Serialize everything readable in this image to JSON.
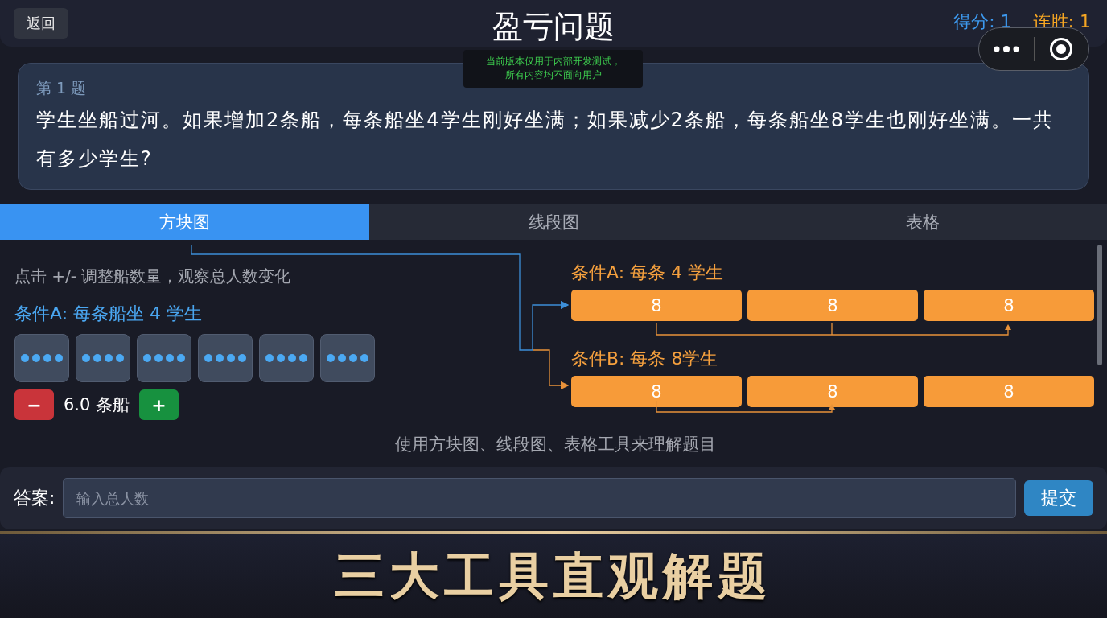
{
  "header": {
    "back_button": "返回",
    "title": "盈亏问题",
    "score": "得分: 1",
    "streak": "连胜: 1"
  },
  "dev_notice": [
    "当前版本仅用于内部开发测试，",
    "所有内容均不面向用户"
  ],
  "question": {
    "number": "第 1 题",
    "text": "学生坐船过河。如果增加2条船，每条船坐4学生刚好坐满；如果减少2条船，每条船坐8学生也刚好坐满。一共有多少学生?"
  },
  "tabs": [
    {
      "label": "方块图",
      "selected": true
    },
    {
      "label": "线段图",
      "selected": false
    },
    {
      "label": "表格",
      "selected": false
    }
  ],
  "block_panel": {
    "hint": "点击 +/- 调整船数量，观察总人数变化",
    "condition": "条件A: 每条船坐 4 学生",
    "boats": [
      {
        "kind": "full"
      },
      {
        "kind": "full"
      },
      {
        "kind": "full"
      },
      {
        "kind": "full"
      },
      {
        "kind": "full"
      },
      {
        "kind": "full"
      }
    ],
    "minus": "−",
    "count": "6.0 条船",
    "plus": "+"
  },
  "segment_panel": {
    "rows": [
      {
        "label": "条件A: 每条 4 学生",
        "segments": [
          "8",
          "8",
          "8"
        ]
      },
      {
        "label": "条件B: 每条 8学生",
        "segments": [
          "8",
          "8",
          "8"
        ]
      }
    ]
  },
  "footer_hint": "使用方块图、线段图、表格工具来理解题目",
  "answer": {
    "label": "答案:",
    "placeholder": "输入总人数",
    "submit": "提交"
  },
  "banner": "三大工具直观解题"
}
